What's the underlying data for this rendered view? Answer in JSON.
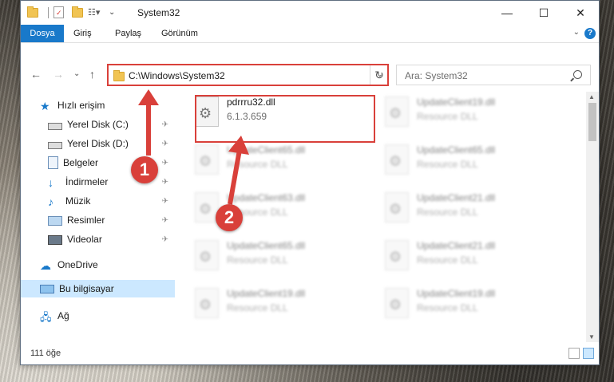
{
  "window": {
    "title": "System32",
    "controls": {
      "minimize": "—",
      "maximize": "☐",
      "close": "✕"
    }
  },
  "ribbon": {
    "tabs": [
      "Dosya",
      "Giriş",
      "Paylaş",
      "Görünüm"
    ],
    "help": "?",
    "collapse": "⌄"
  },
  "nav": {
    "back": "←",
    "forward": "→",
    "recent": "⌄",
    "up": "↑",
    "address": "C:\\Windows\\System32",
    "address_dropdown": "⌄",
    "refresh": "↻",
    "search_placeholder": "Ara: System32"
  },
  "sidebar": {
    "items": [
      {
        "label": "Hızlı erişim",
        "icon": "star-icon",
        "pinned": false
      },
      {
        "label": "Yerel Disk (C:)",
        "icon": "drive-icon",
        "pinned": true
      },
      {
        "label": "Yerel Disk (D:)",
        "icon": "drive-icon",
        "pinned": true
      },
      {
        "label": "Belgeler",
        "icon": "documents-icon",
        "pinned": true
      },
      {
        "label": "İndirmeler",
        "icon": "download-icon",
        "pinned": true
      },
      {
        "label": "Müzik",
        "icon": "music-icon",
        "pinned": true
      },
      {
        "label": "Resimler",
        "icon": "pictures-icon",
        "pinned": true
      },
      {
        "label": "Videolar",
        "icon": "videos-icon",
        "pinned": true
      },
      {
        "label": "OneDrive",
        "icon": "cloud-icon",
        "pinned": false
      },
      {
        "label": "Bu bilgisayar",
        "icon": "computer-icon",
        "pinned": false
      },
      {
        "label": "Ağ",
        "icon": "network-icon",
        "pinned": false
      }
    ],
    "pin_glyph": "📌"
  },
  "files": {
    "focused": {
      "name": "pdrrru32.dll",
      "desc": "6.1.3.659"
    },
    "left_column": [
      {
        "name": "UpdateClient65.dll",
        "desc": "Resource DLL"
      },
      {
        "name": "UpdateClient63.dll",
        "desc": "Resource DLL"
      },
      {
        "name": "UpdateClient65.dll",
        "desc": "Resource DLL"
      },
      {
        "name": "UpdateClient19.dll",
        "desc": "Resource DLL"
      }
    ],
    "right_column": [
      {
        "name": "UpdateClient19.dll",
        "desc": "Resource DLL"
      },
      {
        "name": "UpdateClient65.dll",
        "desc": "Resource DLL"
      },
      {
        "name": "UpdateClient21.dll",
        "desc": "Resource DLL"
      },
      {
        "name": "UpdateClient21.dll",
        "desc": "Resource DLL"
      },
      {
        "name": "UpdateClient19.dll",
        "desc": "Resource DLL"
      }
    ]
  },
  "status": {
    "item_count": "111 öğe"
  },
  "annotations": {
    "step1": "1",
    "step2": "2",
    "color": "#d9403a"
  }
}
